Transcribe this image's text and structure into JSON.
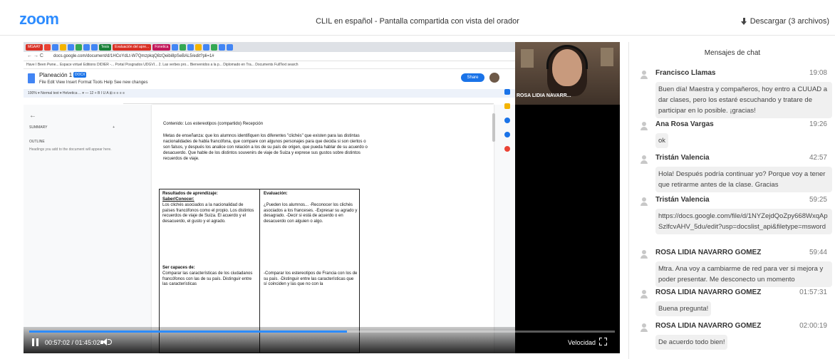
{
  "header": {
    "logo": "zoom",
    "title": "CLIL en español - Pantalla compartida con vista del orador",
    "download": "Descargar (3 archivos)"
  },
  "browser": {
    "tabs": [
      "MGAAY",
      "Tesis",
      "Evaluación del apre...",
      "Fonetica"
    ],
    "tab_colors": [
      "#d93025",
      "#188038",
      "#d93025",
      "#c2185b"
    ],
    "url": "docs.google.com/document/d/1HCoYdLt-W7QmzpkqQ8zQeibi8pSeBAL5/edit?pli=1#",
    "bookmarks": "Have I Been Pwne...   Espace virtuel   Editions DIDIER -...   Portal   Posgrados UDGVI...   2. Las verbes pro...   Bienvenidos a la p...   Diplomado en Tra...   Documents   FullText search"
  },
  "doc": {
    "name": "Planeación 1",
    "badge": "DOCX",
    "menu": "File   Edit   View   Insert   Format   Tools   Help      See new changes",
    "share": "Share",
    "toolbar": "100%  ▾   Normal text  ▾   Helvetica ...  ▾   —  12  +   B  I  U  A   ⊞  ≡  ≡  ≡  ≡",
    "outline_summary": "SUMMARY",
    "outline_label": "OUTLINE",
    "outline_help": "Headings you add to the document will appear here.",
    "content_line": "Contenido: Los estereotipos (compartido) Recepción",
    "metas": "Metas de enseñanza: que los alumnos identifiquen los diferentes \"clichés\" que existen para las distintas nacionalidades de habla francófona, que compare con algunos personajes para que decida si son ciertos o son falsos, y después los analice con relación a los de su país de origen, que pueda hablar de su acuerdo o desacuerdo. Que hable de los distintos souvenirs de viaje de Suiza y exprese sus gustos sobre distintos recuerdos de viaje.",
    "table": {
      "left_header": "Resultados de aprendizaje:",
      "left_sub": "Saber/Conocer:",
      "left_body": "Los clichés asociados a la nacionalidad de países francófonos como el propio. Los distintos recuerdos de viaje de Suiza. El acuerdo y el desacuerdo, el gusto y el agrado.",
      "left_header2": "Ser capaces de:",
      "left_body2": "Comparar las características de los ciudadanos francófonos con las de su país. Distinguir entre las características",
      "right_header": "Evaluación:",
      "right_body": "¿Pueden los alumnos... -Reconocer los clichés asociados a los franceses. -Expresar su agrado y desagrado. -Decir si está de acuerdo o en desacuerdo con alguien o algo.",
      "right_body2": "-Comparar los estereotipos de Francia con los de su país. -Distinguir entre las características que sí coinciden y las que no con la"
    }
  },
  "speaker": {
    "name": "ROSA LIDIA NAVARR..."
  },
  "player": {
    "time": "00:57:02 / 01:45:02",
    "progress": 0.543,
    "speed_label": "Velocidad"
  },
  "chat": {
    "title": "Mensajes de chat",
    "messages": [
      {
        "name": "Francisco Llamas",
        "time": "19:08",
        "text": "Buen día! Maestra y compañeros, hoy entro a CUUAD a dar clases, pero los estaré escuchando y tratare de participar en lo posible. ¡gracias!"
      },
      {
        "name": "Ana Rosa Vargas",
        "time": "19:26",
        "text": "ok"
      },
      {
        "name": "Tristán Valencia",
        "time": "42:57",
        "text": "Hola! Después podría continuar yo? Porque voy a tener que retirarme antes de la clase. Gracias"
      },
      {
        "name": "Tristán Valencia",
        "time": "59:25",
        "text": "https://docs.google.com/file/d/1NYZejdQoZpy668WxqApSzlfcvAHV_5du/edit?usp=docslist_api&filetype=msword"
      },
      {
        "name": "ROSA LIDIA NAVARRO GOMEZ",
        "time": "59:44",
        "text": "Mtra. Ana voy a cambiarme de red para ver si mejora y poder presentar. Me desconecto un momento"
      },
      {
        "name": "ROSA LIDIA NAVARRO GOMEZ",
        "time": "01:57:31",
        "text": "Buena pregunta!"
      },
      {
        "name": "ROSA LIDIA NAVARRO GOMEZ",
        "time": "02:00:19",
        "text": "De acuerdo todo bien!"
      }
    ]
  }
}
